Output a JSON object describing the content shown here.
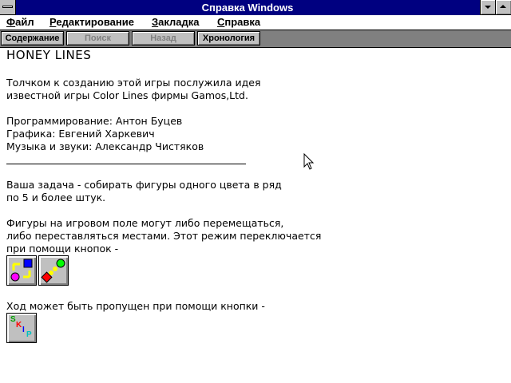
{
  "window": {
    "title": "Справка Windows"
  },
  "menubar": {
    "items": [
      {
        "accel": "Ф",
        "rest": "айл"
      },
      {
        "accel": "Р",
        "rest": "едактирование"
      },
      {
        "accel": "З",
        "rest": "акладка"
      },
      {
        "accel": "С",
        "rest": "правка"
      }
    ]
  },
  "toolbar": {
    "contents": "Содержание",
    "search": "Поиск",
    "back": "Назад",
    "history": "Хронология"
  },
  "content": {
    "heading": "HONEY LINES",
    "lines": [
      "Толчком к созданию этой игры послужила идея",
      "известной игры Color Lines фирмы Gamos,Ltd.",
      "Программирование: Антон Буцев",
      "Графика: Евгений Харкевич",
      "Музыка и звуки: Александр Чистяков",
      "Ваша задача - собирать фигуры одного цвета в ряд",
      "по 5 и более штук.",
      "Фигуры на игровом поле могут либо перемещаться,",
      "либо переставляться местами. Этот режим переключается",
      "при помощи кнопок -",
      "Ход может быть пропущен при помощи кнопки -"
    ],
    "skip_icon_letters": [
      "S",
      "K",
      "I",
      "P"
    ]
  },
  "icons": [
    "system-menu-icon",
    "minimize-icon",
    "maximize-icon",
    "move-mode-icon",
    "swap-mode-icon",
    "skip-icon",
    "mouse-pointer-icon"
  ]
}
